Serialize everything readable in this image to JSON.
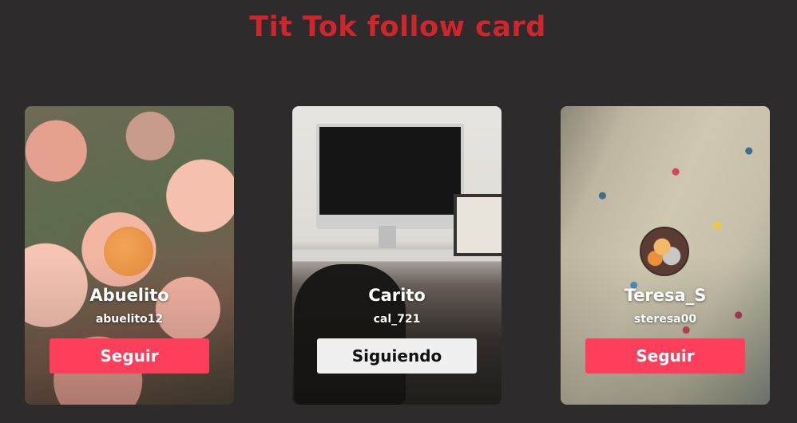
{
  "page": {
    "title": "Tit Tok follow card"
  },
  "cards": [
    {
      "name": "Abuelito",
      "handle": "abuelito12",
      "button_label": "Seguir",
      "following": false
    },
    {
      "name": "Carito",
      "handle": "cal_721",
      "button_label": "Siguiendo",
      "following": true
    },
    {
      "name": "Teresa_S",
      "handle": "steresa00",
      "button_label": "Seguir",
      "following": false
    }
  ],
  "colors": {
    "background": "#2d2b2c",
    "title": "#d0262b",
    "follow_button": "#fd3f5c",
    "following_button": "#f0f0f0"
  }
}
